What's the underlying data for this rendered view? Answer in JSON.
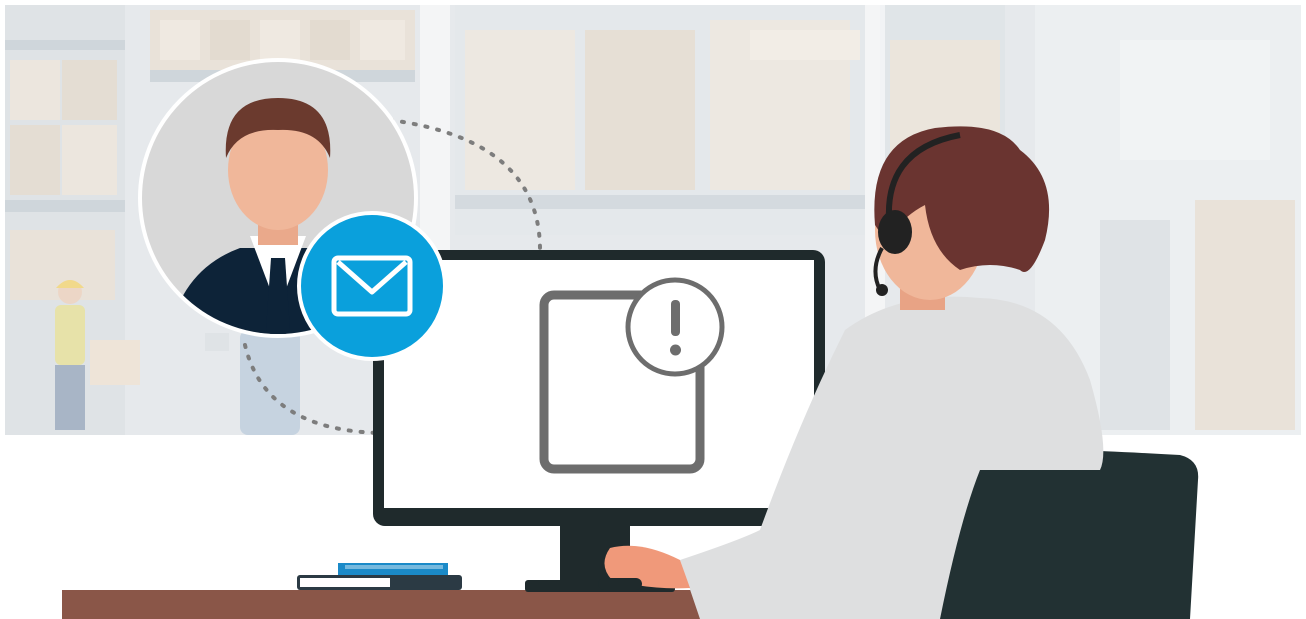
{
  "scene": {
    "alt": "",
    "colors": {
      "sky": "#ffffff",
      "warehouse_bg": "#e6e9ec",
      "shelf": "#d7dde2",
      "box_light": "#e9e2d9",
      "box_dark": "#dcd2c6",
      "desk": "#8a5648",
      "monitor_frame": "#1f2a2c",
      "screen": "#ffffff",
      "doc_stroke": "#6d6d6d",
      "mail_blue": "#0aa0dc",
      "avatar_bg": "#d8d8d8",
      "suit": "#0d2338",
      "skin": "#f0b79a",
      "hair_man": "#6b3a2e",
      "hair_woman": "#6a3430",
      "shirt_woman": "#dedfe0",
      "chair": "#223133",
      "headset": "#222222",
      "book_blue": "#1b8ac8",
      "book_dark": "#2b3a44"
    },
    "icons": [
      "envelope-icon",
      "document-alert-icon",
      "headset-icon"
    ]
  }
}
